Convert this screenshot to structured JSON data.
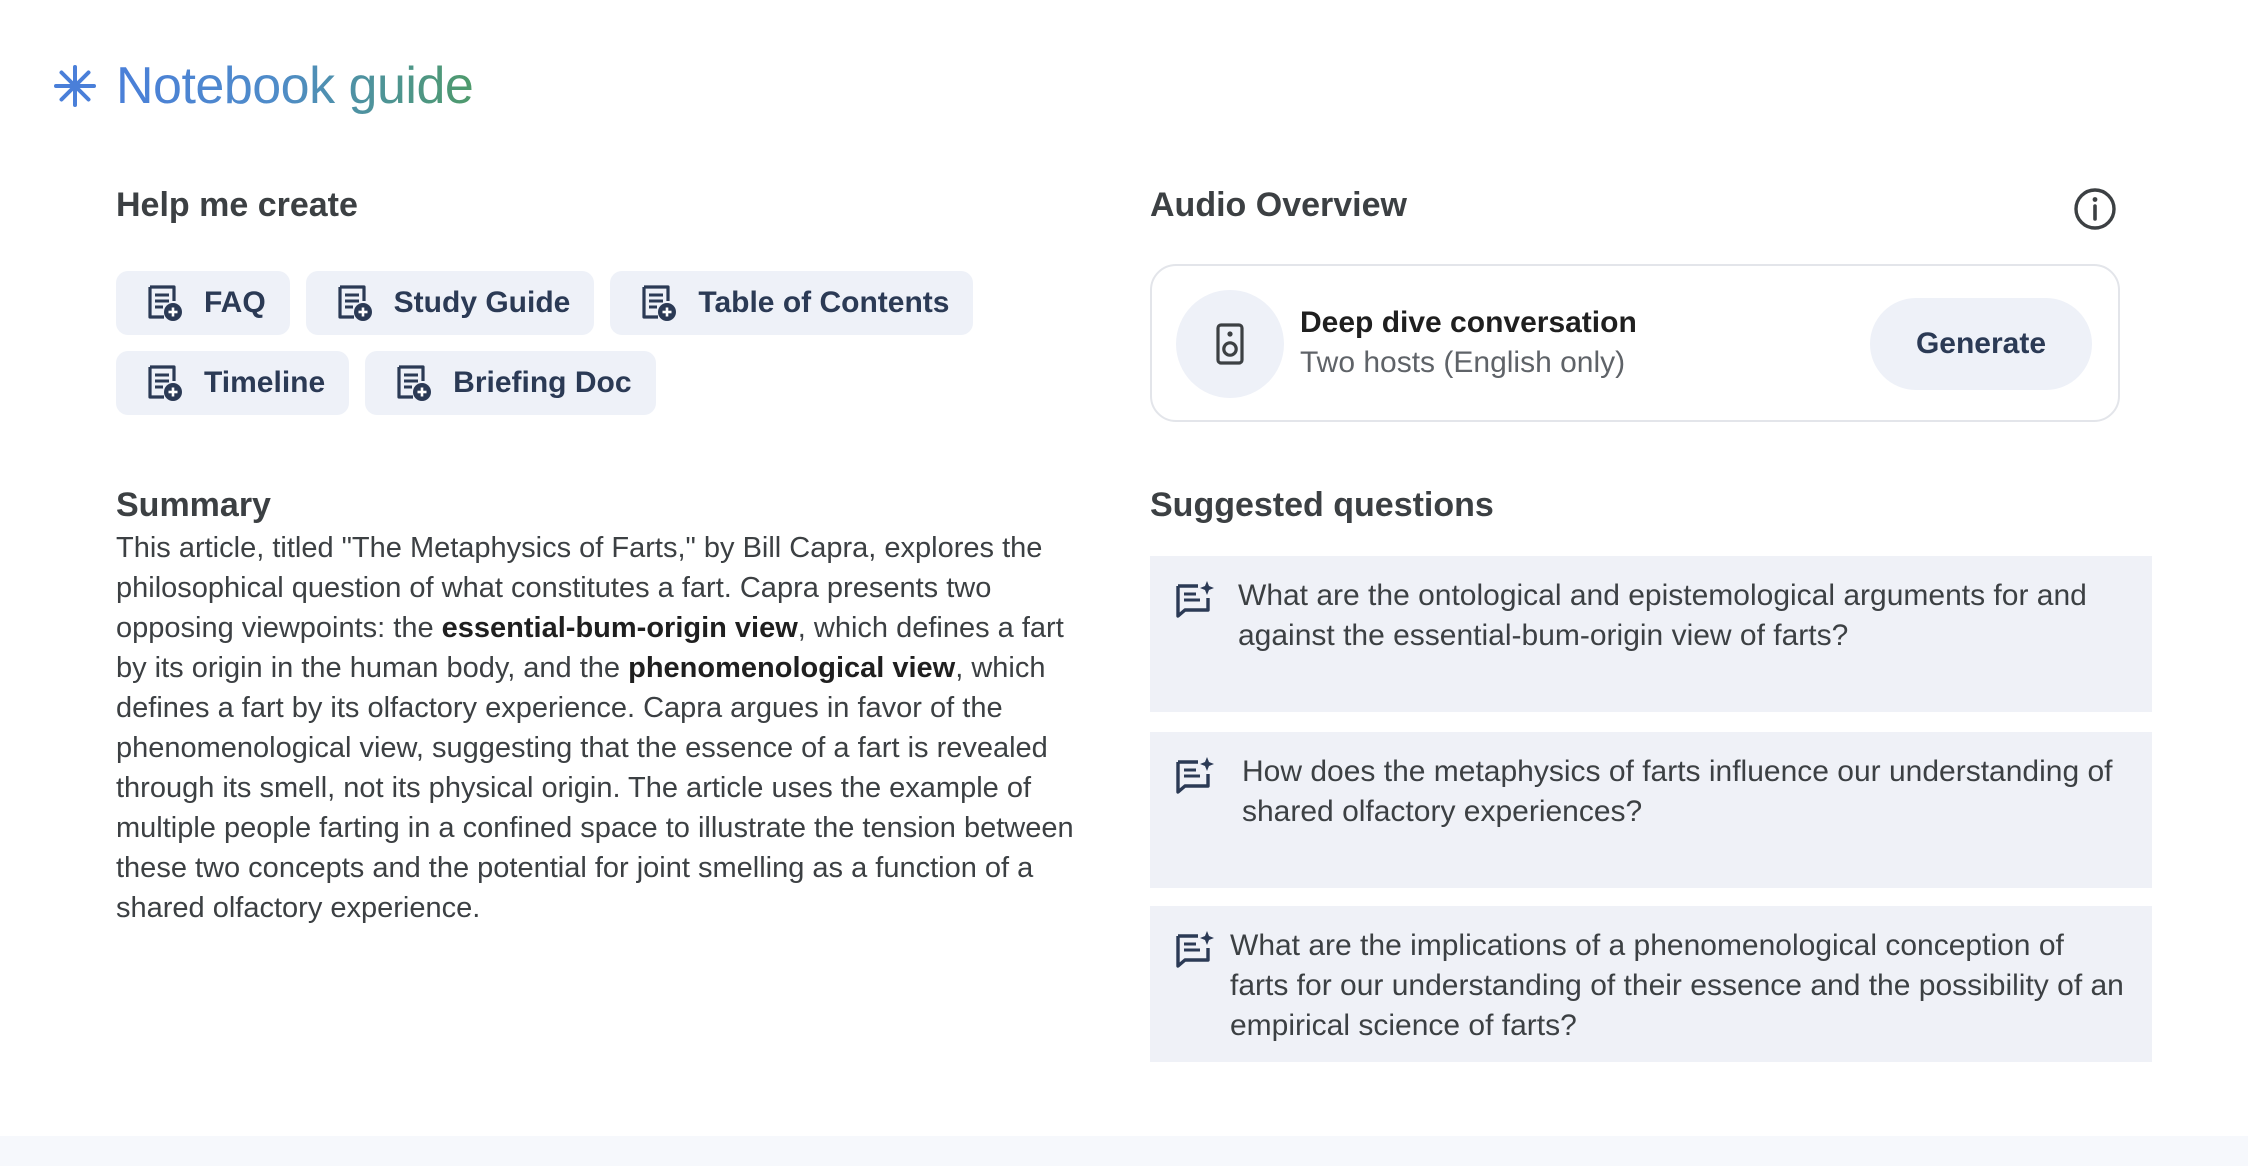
{
  "header": {
    "title": "Notebook guide",
    "icon": "spark-icon"
  },
  "help_create": {
    "heading": "Help me create",
    "buttons": [
      {
        "label": "FAQ",
        "icon": "note-add-icon"
      },
      {
        "label": "Study Guide",
        "icon": "note-add-icon"
      },
      {
        "label": "Table of Contents",
        "icon": "note-add-icon"
      },
      {
        "label": "Timeline",
        "icon": "note-add-icon"
      },
      {
        "label": "Briefing Doc",
        "icon": "note-add-icon"
      }
    ]
  },
  "summary": {
    "heading": "Summary",
    "p1": "This article, titled \"The Metaphysics of Farts,\" by Bill Capra, explores the philosophical question of what constitutes a fart. Capra presents two opposing viewpoints: the ",
    "b1": "essential-bum-origin view",
    "p2": ", which defines a fart by its origin in the human body, and the ",
    "b2": "phenomenological view",
    "p3": ", which defines a fart by its olfactory experience. Capra argues in favor of the phenomenological view, suggesting that the essence of a fart is revealed through its smell, not its physical origin. The article uses the example of multiple people farting in a confined space to illustrate the tension between these two concepts and the potential for joint smelling as a function of a shared olfactory experience."
  },
  "audio_overview": {
    "heading": "Audio Overview",
    "info_icon": "info-icon",
    "card_title": "Deep dive conversation",
    "card_subtitle": "Two hosts (English only)",
    "generate_label": "Generate",
    "speaker_icon": "speaker-icon"
  },
  "suggested_questions": {
    "heading": "Suggested questions",
    "items": [
      "What are the ontological and epistemological arguments for and against the essential-bum-origin view of farts?",
      "How does the metaphysics of farts influence our understanding of shared olfactory experiences?",
      "What are the implications of a phenomenological conception of farts for our understanding of their essence and the possibility of an empirical science of farts?"
    ]
  },
  "colors": {
    "title_gradient_start": "#4a7fd9",
    "title_gradient_end": "#4e9a6b",
    "chip_bg": "#eef1f8",
    "icon_navy": "#2b3a55",
    "question_bg": "#eff1f7"
  }
}
